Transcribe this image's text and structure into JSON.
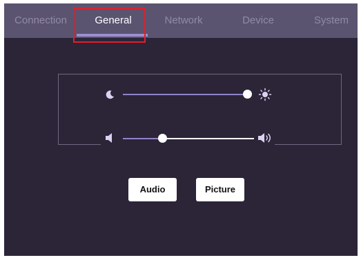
{
  "tabs": [
    {
      "label": "Connection",
      "active": false
    },
    {
      "label": "General",
      "active": true
    },
    {
      "label": "Network",
      "active": false
    },
    {
      "label": "Device",
      "active": false
    },
    {
      "label": "System",
      "active": false
    }
  ],
  "brightness": {
    "min_icon": "moon-icon",
    "max_icon": "sun-icon",
    "level": 1.0
  },
  "volume": {
    "min_icon": "speaker-low-icon",
    "max_icon": "speaker-high-icon",
    "level": 0.3
  },
  "buttons": {
    "audio_label": "Audio",
    "picture_label": "Picture"
  },
  "colors": {
    "accent": "#9b8ed3",
    "highlight": "#e0202a",
    "background": "#2c2538",
    "tabbar": "#5b5470"
  }
}
